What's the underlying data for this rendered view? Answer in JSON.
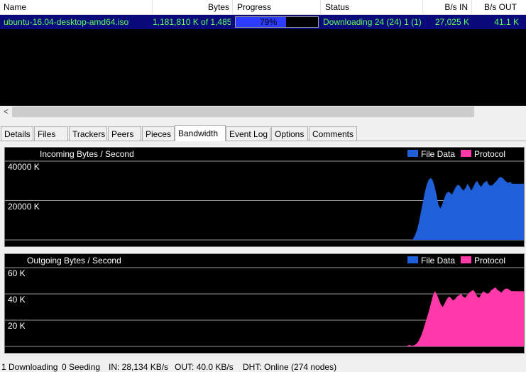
{
  "columns": {
    "name": "Name",
    "bytes": "Bytes",
    "progress": "Progress",
    "status": "Status",
    "bs_in": "B/s IN",
    "bs_out": "B/s OUT"
  },
  "torrent": {
    "name": "ubuntu-16.04-desktop-amd64.iso",
    "bytes": "1,181,810 K of 1,485,8",
    "progress_text": "79%",
    "progress_fraction": 0.79,
    "status": "Downloading 24 (24) 1 (1)",
    "bs_in": "27,025 K",
    "bs_out": "41.1 K"
  },
  "scroll_left_arrow": "<",
  "tabs": [
    "Details",
    "Files",
    "Trackers",
    "Peers",
    "Pieces",
    "Bandwidth",
    "Event Log",
    "Options",
    "Comments"
  ],
  "active_tab": "Bandwidth",
  "incoming": {
    "title": "Incoming Bytes / Second",
    "legend_file": "File Data",
    "legend_protocol": "Protocol",
    "y_labels": [
      "40000 K",
      "20000 K"
    ],
    "series_color": "#1f5fd8",
    "protocol_color": "#ff3aa8",
    "values": [
      0,
      0,
      0,
      0,
      0,
      0,
      0,
      0,
      0,
      0,
      0,
      0,
      0,
      0,
      0,
      0,
      0,
      0,
      0,
      0,
      0,
      0,
      0,
      0,
      0,
      0,
      0,
      0,
      0,
      0,
      0,
      0,
      0,
      0,
      0,
      0,
      0,
      0,
      0,
      0,
      0,
      0,
      0,
      0,
      0,
      0,
      0,
      0,
      0,
      0,
      0,
      0,
      0,
      0,
      0,
      0,
      0,
      0,
      0,
      0,
      0,
      0,
      0,
      0,
      0,
      0,
      0,
      0,
      0,
      0,
      0,
      0,
      0,
      0,
      0,
      0,
      0,
      0,
      0,
      0,
      0,
      0,
      0,
      0,
      0,
      0,
      0,
      0,
      0,
      0,
      0,
      0,
      0,
      0,
      0,
      0,
      0,
      0,
      0,
      0,
      0,
      0,
      0,
      0,
      0,
      0,
      0,
      0,
      0,
      0,
      0,
      0,
      0,
      0,
      0,
      0,
      0,
      0,
      0,
      0,
      0,
      0,
      0,
      0,
      0,
      0,
      0,
      0,
      0,
      0,
      0,
      0,
      0,
      0,
      0,
      0,
      0,
      0,
      0,
      0,
      0,
      0,
      0,
      0,
      0,
      0,
      0,
      0,
      0,
      0,
      0,
      0,
      0,
      0,
      0,
      0,
      0,
      0,
      0,
      0,
      0,
      0,
      0,
      0,
      0,
      0,
      0,
      0,
      0,
      0,
      0,
      0,
      0,
      0,
      0,
      0,
      0,
      0,
      0,
      0,
      0,
      0,
      0,
      0,
      0,
      0,
      0,
      0,
      0,
      0,
      0,
      0,
      0,
      0,
      0,
      0,
      0,
      0,
      0,
      0,
      0,
      0,
      0,
      0,
      0,
      0,
      0,
      0,
      0,
      0,
      500,
      2500,
      5000,
      9000,
      14000,
      19000,
      24000,
      28000,
      30500,
      31500,
      30500,
      27500,
      23000,
      18000,
      16000,
      18000,
      21000,
      23500,
      24500,
      24000,
      23000,
      25000,
      27000,
      28000,
      27500,
      26000,
      25000,
      26500,
      28500,
      27000,
      25000,
      27000,
      29000,
      30000,
      28000,
      27000,
      28500,
      29500,
      30000,
      28000,
      27500,
      28000,
      29000,
      30000,
      31500,
      32000,
      31500,
      30500,
      29500,
      29000,
      29500,
      28500,
      28500,
      28500,
      28500,
      28500,
      28500,
      28500
    ]
  },
  "outgoing": {
    "title": "Outgoing Bytes / Second",
    "legend_file": "File Data",
    "legend_protocol": "Protocol",
    "y_labels": [
      "60 K",
      "40 K",
      "20 K"
    ],
    "series_color": "#ff3aa8",
    "file_color": "#1f5fd8",
    "values": [
      0,
      0,
      0,
      0,
      0,
      0,
      0,
      0,
      0,
      0,
      0,
      0,
      0,
      0,
      0,
      0,
      0,
      0,
      0,
      0,
      0,
      0,
      0,
      0,
      0,
      0,
      0,
      0,
      0,
      0,
      0,
      0,
      0,
      0,
      0,
      0,
      0,
      0,
      0,
      0,
      0,
      0,
      0,
      0,
      0,
      0,
      0,
      0,
      0,
      0,
      0,
      0,
      0,
      0,
      0,
      0,
      0,
      0,
      0,
      0,
      0,
      0,
      0,
      0,
      0,
      0,
      0,
      0,
      0,
      0,
      0,
      0,
      0,
      0,
      0,
      0,
      0,
      0,
      0,
      0,
      0,
      0,
      0,
      0,
      0,
      0,
      0,
      0,
      0,
      0,
      0,
      0,
      0,
      0,
      0,
      0,
      0,
      0,
      0,
      0,
      0,
      0,
      0,
      0,
      0,
      0,
      0,
      0,
      0,
      0,
      0,
      0,
      0,
      0,
      0,
      0,
      0,
      0,
      0,
      0,
      0,
      0,
      0,
      0,
      0,
      0,
      0,
      0,
      0,
      0,
      0,
      0,
      0,
      0,
      0,
      0,
      0,
      0,
      0,
      0,
      0,
      0,
      0,
      0,
      0,
      0,
      0,
      0,
      0,
      0,
      0,
      0,
      0,
      0,
      0,
      0,
      0,
      0,
      0,
      0,
      0,
      0,
      0,
      0,
      0,
      0,
      0,
      0,
      0,
      0,
      0,
      0,
      0,
      0,
      0,
      0,
      0,
      0,
      0,
      0,
      0,
      0,
      0,
      0,
      0,
      0,
      0,
      0,
      0,
      0,
      0,
      0,
      0,
      0,
      0,
      0,
      0,
      0,
      0,
      1,
      1,
      0.5,
      1,
      2,
      4,
      7,
      11,
      16,
      21,
      26,
      32,
      38,
      42,
      40,
      36,
      32,
      30,
      33,
      36,
      38,
      37,
      35,
      36,
      38,
      39,
      40,
      38,
      37,
      39,
      41,
      42,
      43,
      41,
      38,
      37,
      40,
      42,
      41,
      40,
      41,
      43,
      44,
      45,
      43,
      42,
      41,
      43,
      44,
      44,
      43,
      42,
      42,
      42,
      42,
      42,
      42,
      42
    ]
  },
  "statusbar": {
    "downloading": "1 Downloading",
    "seeding": "0 Seeding",
    "in": "IN: 28,134 KB/s",
    "out": "OUT: 40.0 KB/s",
    "dht": "DHT: Online (274 nodes)"
  }
}
